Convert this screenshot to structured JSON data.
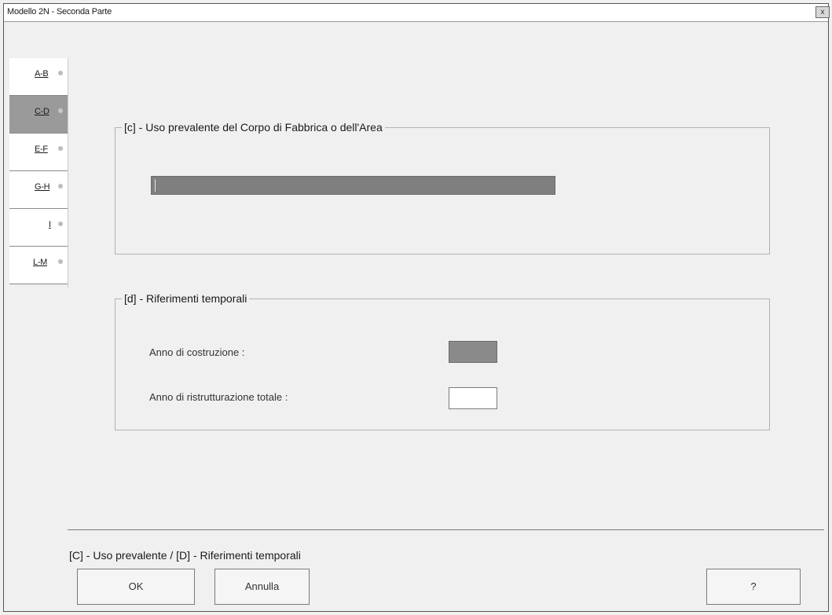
{
  "window": {
    "title": "Modello 2N - Seconda Parte",
    "close_glyph": "x"
  },
  "tabs": [
    {
      "label": "A-B",
      "selected": false
    },
    {
      "label": "C-D",
      "selected": true
    },
    {
      "label": "E-F",
      "selected": false
    },
    {
      "label": "G-H",
      "selected": false
    },
    {
      "label": "I",
      "selected": false
    },
    {
      "label": "L-M",
      "selected": false
    }
  ],
  "section_c": {
    "legend": "[c] - Uso prevalente del Corpo di Fabbrica o dell'Area",
    "field_value": ""
  },
  "section_d": {
    "legend": "[d] - Riferimenti temporali",
    "anno_costruzione_label": "Anno di costruzione :",
    "anno_costruzione_value": "",
    "anno_ristrutturazione_label": "Anno di ristrutturazione totale :",
    "anno_ristrutturazione_value": ""
  },
  "status": {
    "text": "[C] - Uso prevalente / [D] - Riferimenti temporali"
  },
  "buttons": {
    "ok": "OK",
    "annulla": "Annulla",
    "help": "?"
  },
  "colors": {
    "selected_tab": "#9a9a9a",
    "disabled_field": "#7f7f7f",
    "background": "#f0f0f0"
  }
}
